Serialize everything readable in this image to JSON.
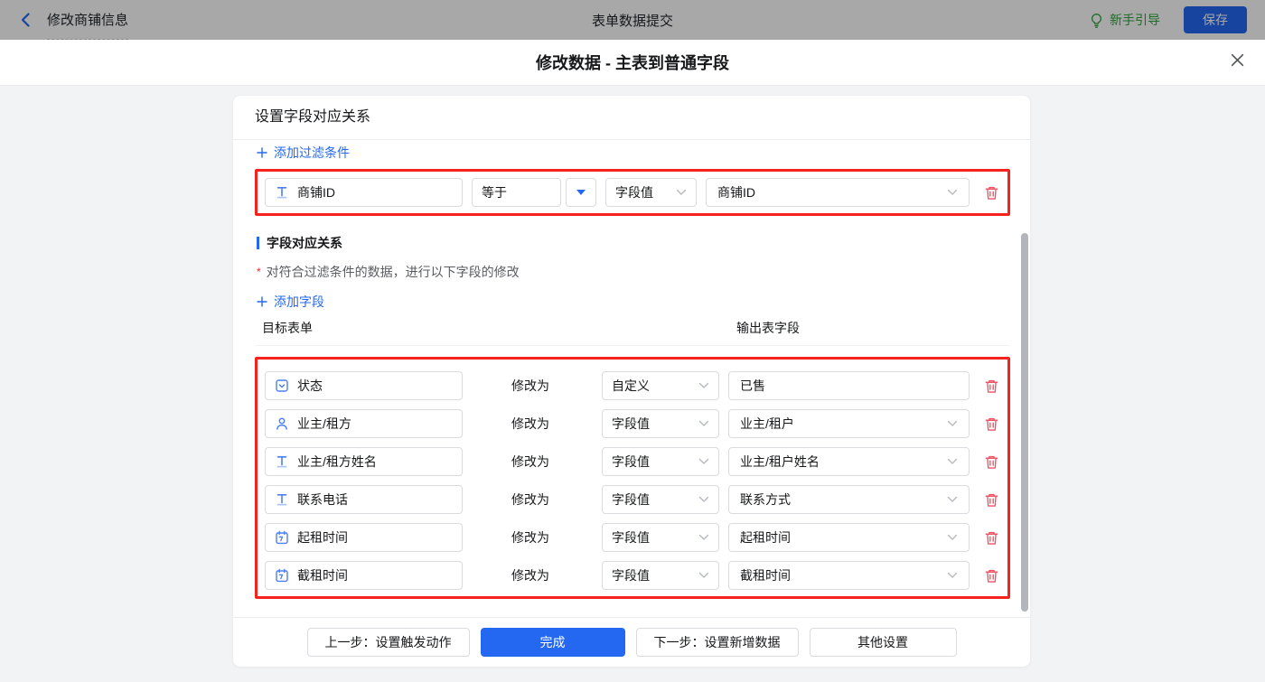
{
  "colors": {
    "primary": "#2468f2",
    "danger": "#ed5565",
    "annotation_red": "#f5221d",
    "guide_green": "#2ea53c"
  },
  "topbar": {
    "back_title": "修改商铺信息",
    "center_title": "表单数据提交",
    "guide_label": "新手引导",
    "save_label": "保存"
  },
  "modal": {
    "title": "修改数据 - 主表到普通字段"
  },
  "card": {
    "header": "设置字段对应关系",
    "add_filter_label": "添加过滤条件",
    "filter_row": {
      "field": "商铺ID",
      "field_icon": "text-field",
      "operator": "等于",
      "value_type": "字段值",
      "value": "商铺ID"
    },
    "section": {
      "title": "字段对应关系",
      "required_mark": "*",
      "note": "对符合过滤条件的数据，进行以下字段的修改",
      "add_field_label": "添加字段",
      "col_left": "目标表单",
      "col_right": "输出表字段",
      "modify_label": "修改为",
      "rows": [
        {
          "icon": "select-field",
          "field": "状态",
          "type": "自定义",
          "value": "已售",
          "value_is_select": false
        },
        {
          "icon": "person",
          "field": "业主/租方",
          "type": "字段值",
          "value": "业主/租户",
          "value_is_select": true
        },
        {
          "icon": "text-field",
          "field": "业主/租方姓名",
          "type": "字段值",
          "value": "业主/租户姓名",
          "value_is_select": true
        },
        {
          "icon": "text-field",
          "field": "联系电话",
          "type": "字段值",
          "value": "联系方式",
          "value_is_select": true
        },
        {
          "icon": "calendar",
          "field": "起租时间",
          "type": "字段值",
          "value": "起租时间",
          "value_is_select": true
        },
        {
          "icon": "calendar",
          "field": "截租时间",
          "type": "字段值",
          "value": "截租时间",
          "value_is_select": true
        }
      ]
    },
    "footer": {
      "prev": "上一步：设置触发动作",
      "done": "完成",
      "next": "下一步：设置新增数据",
      "other": "其他设置"
    }
  }
}
